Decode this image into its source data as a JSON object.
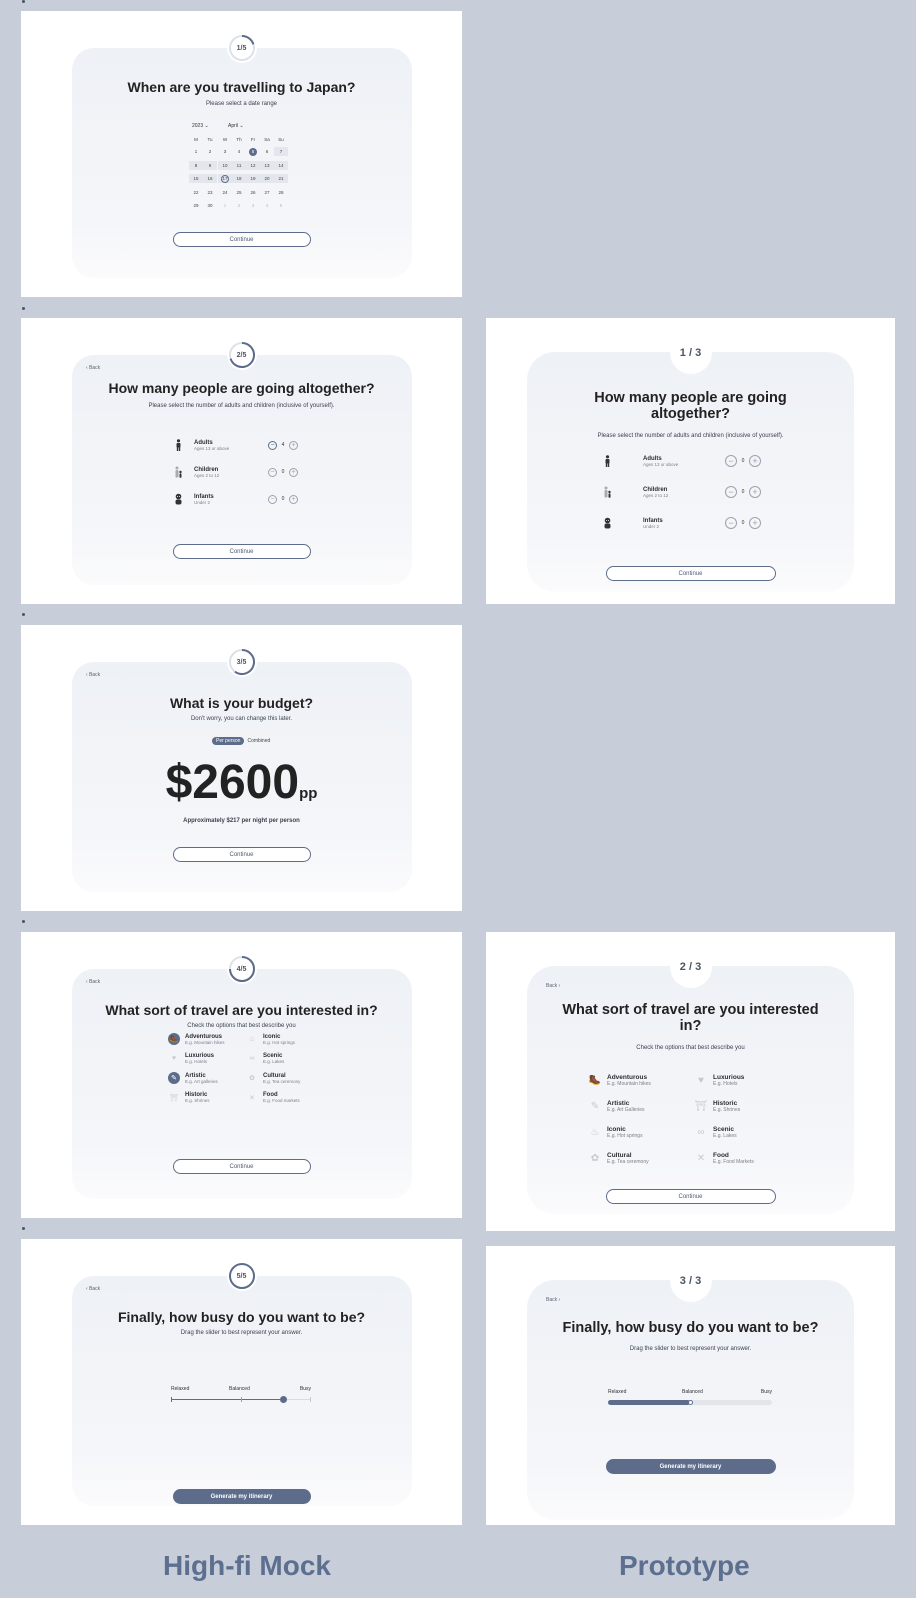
{
  "colors": {
    "accent": "#5c6c8a",
    "background": "#c8ced9",
    "card": "#f1f3f7"
  },
  "mock": {
    "date": {
      "badge": "1/5",
      "title": "When are you travelling to Japan?",
      "subtitle": "Please select a date range",
      "year": "2023",
      "month": "April",
      "weekdays": [
        "M",
        "Tu",
        "W",
        "Th",
        "Fr",
        "Sa",
        "Su"
      ],
      "weeks": [
        [
          "1",
          "2",
          "3",
          "4",
          "5",
          "6",
          "7"
        ],
        [
          "8",
          "9",
          "10",
          "11",
          "12",
          "13",
          "14"
        ],
        [
          "15",
          "16",
          "17",
          "18",
          "19",
          "20",
          "21"
        ],
        [
          "22",
          "23",
          "24",
          "25",
          "26",
          "27",
          "28"
        ],
        [
          "29",
          "30",
          "1",
          "2",
          "3",
          "4",
          "5"
        ]
      ],
      "continue": "Continue"
    },
    "people": {
      "badge": "2/5",
      "back": "Back",
      "title": "How many people are going altogether?",
      "subtitle": "Please select the number of adults and children (inclusive of yourself).",
      "rows": [
        {
          "label": "Adults",
          "sub": "Ages 13 or above",
          "value": "4",
          "icon": "adult-icon"
        },
        {
          "label": "Children",
          "sub": "Ages 2 to 12",
          "value": "0",
          "icon": "child-icon"
        },
        {
          "label": "Infants",
          "sub": "Under 2",
          "value": "0",
          "icon": "infant-icon"
        }
      ],
      "minus": "−",
      "plus": "+",
      "continue": "Continue"
    },
    "budget": {
      "badge": "3/5",
      "back": "Back",
      "title": "What is your budget?",
      "subtitle": "Don't worry, you can change this later.",
      "toggle_on": "Per person",
      "toggle_off": "Combined",
      "amount": "$2600",
      "unit": "pp",
      "note": "Approximately $217 per night per person",
      "continue": "Continue"
    },
    "travel": {
      "badge": "4/5",
      "back": "Back",
      "title": "What sort of travel are you interested in?",
      "subtitle": "Check the options that best describe you",
      "left": [
        {
          "label": "Adventurous",
          "sub": "E.g. Mountain hikes",
          "on": true
        },
        {
          "label": "Luxurious",
          "sub": "E.g. Hotels",
          "on": false
        },
        {
          "label": "Artistic",
          "sub": "E.g. Art galleries",
          "on": true
        },
        {
          "label": "Historic",
          "sub": "E.g. Shrines",
          "on": false
        }
      ],
      "right": [
        {
          "label": "Iconic",
          "sub": "E.g. Hot springs"
        },
        {
          "label": "Scenic",
          "sub": "E.g. Lakes"
        },
        {
          "label": "Cultural",
          "sub": "E.g. Tea ceremony"
        },
        {
          "label": "Food",
          "sub": "E.g. Food markets"
        }
      ],
      "continue": "Continue"
    },
    "busy": {
      "badge": "5/5",
      "back": "Back",
      "title": "Finally, how busy do you want to be?",
      "subtitle": "Drag the slider to best represent your answer.",
      "labels": [
        "Relaxed",
        "Balanced",
        "Busy"
      ],
      "level": 0.8,
      "button": "Generate my itinerary"
    }
  },
  "proto": {
    "people": {
      "badge": "1 / 3",
      "title": "How many people are going altogether?",
      "subtitle": "Please select the number of adults and children (inclusive of yourself).",
      "rows": [
        {
          "label": "Adults",
          "sub": "Ages 13 or above",
          "value": "0"
        },
        {
          "label": "Children",
          "sub": "Ages 2 to 12",
          "value": "0"
        },
        {
          "label": "Infants",
          "sub": "Under 2",
          "value": "0"
        }
      ],
      "minus": "−",
      "plus": "+",
      "continue": "Continue"
    },
    "travel": {
      "badge": "2 / 3",
      "back": "Back",
      "title": "What sort of travel are you interested in?",
      "subtitle": "Check the options that best describe you",
      "left": [
        {
          "label": "Adventurous",
          "sub": "E.g. Mountain hikes"
        },
        {
          "label": "Artistic",
          "sub": "E.g. Art Galleries"
        },
        {
          "label": "Iconic",
          "sub": "E.g. Hot springs"
        },
        {
          "label": "Cultural",
          "sub": "E.g. Tea ceremony"
        }
      ],
      "right": [
        {
          "label": "Luxurious",
          "sub": "E.g. Hotels"
        },
        {
          "label": "Historic",
          "sub": "E.g. Shrines"
        },
        {
          "label": "Scenic",
          "sub": "E.g. Lakes"
        },
        {
          "label": "Food",
          "sub": "E.g. Food Markets"
        }
      ],
      "continue": "Continue"
    },
    "busy": {
      "badge": "3 / 3",
      "back": "Back",
      "title": "Finally, how busy do you want to be?",
      "subtitle": "Drag the slider to best represent your answer.",
      "labels": [
        "Relaxed",
        "Balanced",
        "Busy"
      ],
      "level": 0.5,
      "button": "Generate my itinerary"
    }
  },
  "footer": {
    "left": "High-fi Mock",
    "right": "Prototype"
  }
}
